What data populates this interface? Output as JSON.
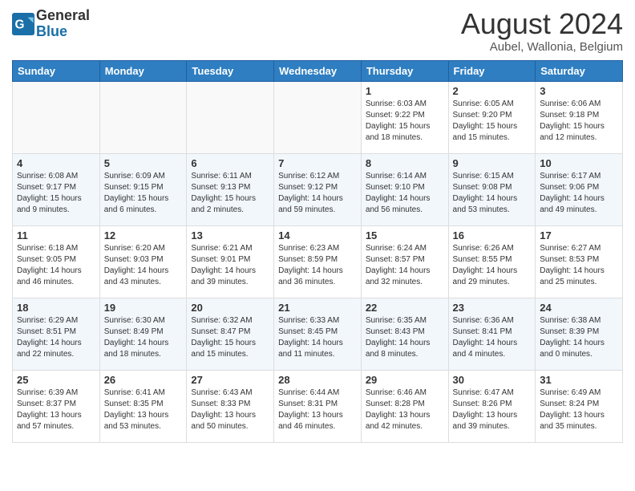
{
  "header": {
    "logo_general": "General",
    "logo_blue": "Blue",
    "month_title": "August 2024",
    "location": "Aubel, Wallonia, Belgium"
  },
  "days_of_week": [
    "Sunday",
    "Monday",
    "Tuesday",
    "Wednesday",
    "Thursday",
    "Friday",
    "Saturday"
  ],
  "weeks": [
    [
      {
        "day": "",
        "info": ""
      },
      {
        "day": "",
        "info": ""
      },
      {
        "day": "",
        "info": ""
      },
      {
        "day": "",
        "info": ""
      },
      {
        "day": "1",
        "info": "Sunrise: 6:03 AM\nSunset: 9:22 PM\nDaylight: 15 hours\nand 18 minutes."
      },
      {
        "day": "2",
        "info": "Sunrise: 6:05 AM\nSunset: 9:20 PM\nDaylight: 15 hours\nand 15 minutes."
      },
      {
        "day": "3",
        "info": "Sunrise: 6:06 AM\nSunset: 9:18 PM\nDaylight: 15 hours\nand 12 minutes."
      }
    ],
    [
      {
        "day": "4",
        "info": "Sunrise: 6:08 AM\nSunset: 9:17 PM\nDaylight: 15 hours\nand 9 minutes."
      },
      {
        "day": "5",
        "info": "Sunrise: 6:09 AM\nSunset: 9:15 PM\nDaylight: 15 hours\nand 6 minutes."
      },
      {
        "day": "6",
        "info": "Sunrise: 6:11 AM\nSunset: 9:13 PM\nDaylight: 15 hours\nand 2 minutes."
      },
      {
        "day": "7",
        "info": "Sunrise: 6:12 AM\nSunset: 9:12 PM\nDaylight: 14 hours\nand 59 minutes."
      },
      {
        "day": "8",
        "info": "Sunrise: 6:14 AM\nSunset: 9:10 PM\nDaylight: 14 hours\nand 56 minutes."
      },
      {
        "day": "9",
        "info": "Sunrise: 6:15 AM\nSunset: 9:08 PM\nDaylight: 14 hours\nand 53 minutes."
      },
      {
        "day": "10",
        "info": "Sunrise: 6:17 AM\nSunset: 9:06 PM\nDaylight: 14 hours\nand 49 minutes."
      }
    ],
    [
      {
        "day": "11",
        "info": "Sunrise: 6:18 AM\nSunset: 9:05 PM\nDaylight: 14 hours\nand 46 minutes."
      },
      {
        "day": "12",
        "info": "Sunrise: 6:20 AM\nSunset: 9:03 PM\nDaylight: 14 hours\nand 43 minutes."
      },
      {
        "day": "13",
        "info": "Sunrise: 6:21 AM\nSunset: 9:01 PM\nDaylight: 14 hours\nand 39 minutes."
      },
      {
        "day": "14",
        "info": "Sunrise: 6:23 AM\nSunset: 8:59 PM\nDaylight: 14 hours\nand 36 minutes."
      },
      {
        "day": "15",
        "info": "Sunrise: 6:24 AM\nSunset: 8:57 PM\nDaylight: 14 hours\nand 32 minutes."
      },
      {
        "day": "16",
        "info": "Sunrise: 6:26 AM\nSunset: 8:55 PM\nDaylight: 14 hours\nand 29 minutes."
      },
      {
        "day": "17",
        "info": "Sunrise: 6:27 AM\nSunset: 8:53 PM\nDaylight: 14 hours\nand 25 minutes."
      }
    ],
    [
      {
        "day": "18",
        "info": "Sunrise: 6:29 AM\nSunset: 8:51 PM\nDaylight: 14 hours\nand 22 minutes."
      },
      {
        "day": "19",
        "info": "Sunrise: 6:30 AM\nSunset: 8:49 PM\nDaylight: 14 hours\nand 18 minutes."
      },
      {
        "day": "20",
        "info": "Sunrise: 6:32 AM\nSunset: 8:47 PM\nDaylight: 15 hours\nand 15 minutes."
      },
      {
        "day": "21",
        "info": "Sunrise: 6:33 AM\nSunset: 8:45 PM\nDaylight: 14 hours\nand 11 minutes."
      },
      {
        "day": "22",
        "info": "Sunrise: 6:35 AM\nSunset: 8:43 PM\nDaylight: 14 hours\nand 8 minutes."
      },
      {
        "day": "23",
        "info": "Sunrise: 6:36 AM\nSunset: 8:41 PM\nDaylight: 14 hours\nand 4 minutes."
      },
      {
        "day": "24",
        "info": "Sunrise: 6:38 AM\nSunset: 8:39 PM\nDaylight: 14 hours\nand 0 minutes."
      }
    ],
    [
      {
        "day": "25",
        "info": "Sunrise: 6:39 AM\nSunset: 8:37 PM\nDaylight: 13 hours\nand 57 minutes."
      },
      {
        "day": "26",
        "info": "Sunrise: 6:41 AM\nSunset: 8:35 PM\nDaylight: 13 hours\nand 53 minutes."
      },
      {
        "day": "27",
        "info": "Sunrise: 6:43 AM\nSunset: 8:33 PM\nDaylight: 13 hours\nand 50 minutes."
      },
      {
        "day": "28",
        "info": "Sunrise: 6:44 AM\nSunset: 8:31 PM\nDaylight: 13 hours\nand 46 minutes."
      },
      {
        "day": "29",
        "info": "Sunrise: 6:46 AM\nSunset: 8:28 PM\nDaylight: 13 hours\nand 42 minutes."
      },
      {
        "day": "30",
        "info": "Sunrise: 6:47 AM\nSunset: 8:26 PM\nDaylight: 13 hours\nand 39 minutes."
      },
      {
        "day": "31",
        "info": "Sunrise: 6:49 AM\nSunset: 8:24 PM\nDaylight: 13 hours\nand 35 minutes."
      }
    ]
  ]
}
